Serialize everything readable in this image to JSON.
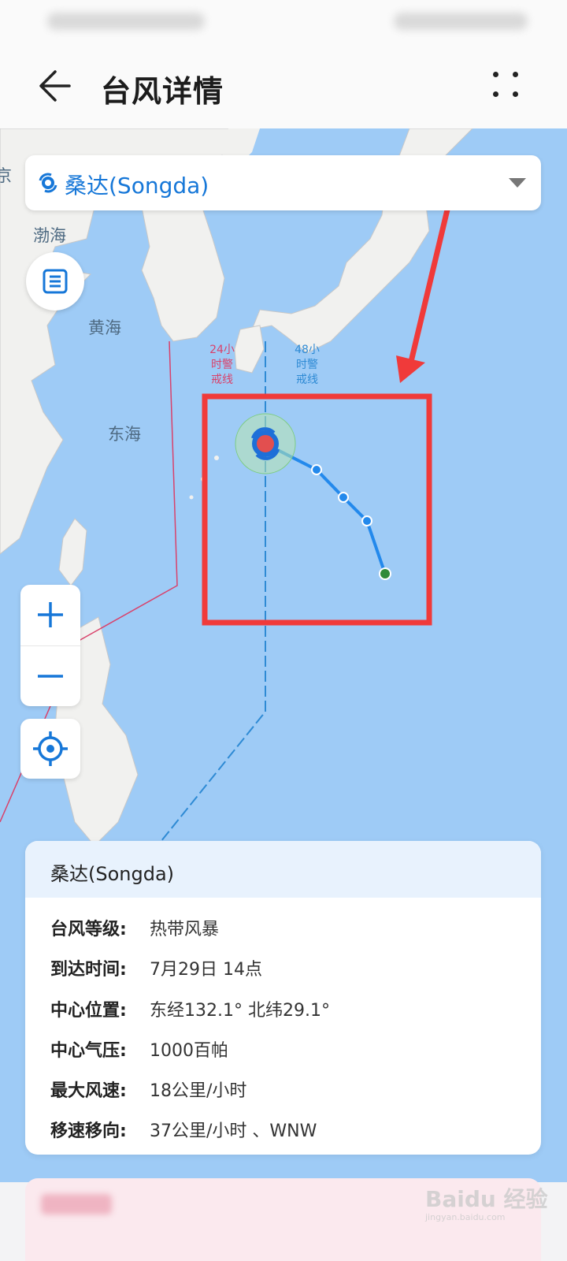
{
  "header": {
    "title": "台风详情",
    "back_icon": "back-arrow-icon",
    "more_icon": "more-dots-icon"
  },
  "map": {
    "typhoon_selector": {
      "name": "桑达(Songda)",
      "icon": "typhoon-icon",
      "dropdown_icon": "caret-down-icon"
    },
    "labels": {
      "bohai": "渤海",
      "huanghai": "黄海",
      "donghai": "东海",
      "edge_city": "京"
    },
    "warning_lines": {
      "line_24h": "24小时警戒线",
      "line_48h": "48小时警戒线",
      "color_24h": "#d9416a",
      "color_48h": "#2e8ad4"
    },
    "controls": {
      "zoom_in_icon": "plus-icon",
      "zoom_out_icon": "minus-icon",
      "locate_icon": "crosshair-icon",
      "list_icon": "list-icon"
    },
    "annotation_color": "#f03a3a"
  },
  "info_card": {
    "title": "桑达(Songda)",
    "rows": [
      {
        "key": "台风等级:",
        "value": "热带风暴"
      },
      {
        "key": "到达时间:",
        "value": "7月29日 14点"
      },
      {
        "key": "中心位置:",
        "value": "东经132.1° 北纬29.1°"
      },
      {
        "key": "中心气压:",
        "value": "1000百帕"
      },
      {
        "key": "最大风速:",
        "value": "18公里/小时"
      },
      {
        "key": "移速移向:",
        "value": "37公里/小时 、WNW"
      }
    ]
  },
  "watermark": {
    "brand": "Baidu 经验",
    "url": "jingyan.baidu.com"
  }
}
